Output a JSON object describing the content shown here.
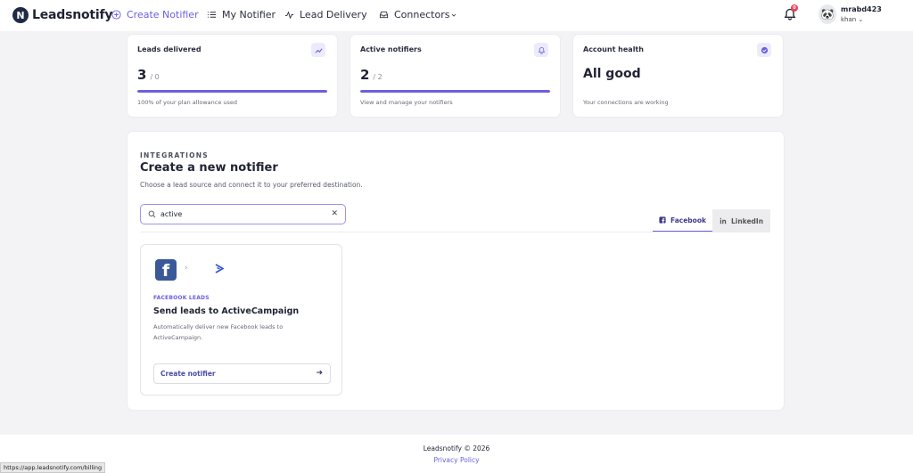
{
  "brand": {
    "name": "Leadsnotify",
    "mark": "N"
  },
  "nav": {
    "create": "Create Notifier",
    "my": "My Notifier",
    "delivery": "Lead Delivery",
    "connectors": "Connectors"
  },
  "notifications": {
    "count": "0"
  },
  "user": {
    "name": "mrabd423",
    "sub": "khan"
  },
  "stats": {
    "leads": {
      "label": "Leads delivered",
      "value": "3",
      "of": "/ 0",
      "progress": 1.0,
      "sub": "100% of your plan allowance used"
    },
    "notifiers": {
      "label": "Active notifiers",
      "value": "2",
      "of": "/ 2",
      "progress": 1.0,
      "sub": "View and manage your notifiers"
    },
    "health": {
      "label": "Account health",
      "value": "All good",
      "sub": "Your connections are working"
    }
  },
  "integrations": {
    "eyebrow": "INTEGRATIONS",
    "title": "Create a new notifier",
    "subtitle": "Choose a lead source and connect it to your preferred destination.",
    "search_value": "active",
    "tabs": [
      {
        "label": "Facebook"
      },
      {
        "label": "LinkedIn"
      }
    ],
    "cards": [
      {
        "eyebrow": "FACEBOOK LEADS",
        "title": "Send leads to ActiveCampaign",
        "description": "Automatically deliver new Facebook leads to ActiveCampaign.",
        "button": "Create notifier"
      }
    ]
  },
  "footer": {
    "copyright": "Leadsnotify © 2026",
    "privacy": "Privacy Policy"
  },
  "status_bar": {
    "url": "https://app.leadsnotify.com/billing"
  },
  "colors": {
    "accent": "#6a5fe0",
    "facebook": "#3b5998",
    "alert": "#e8435a"
  }
}
